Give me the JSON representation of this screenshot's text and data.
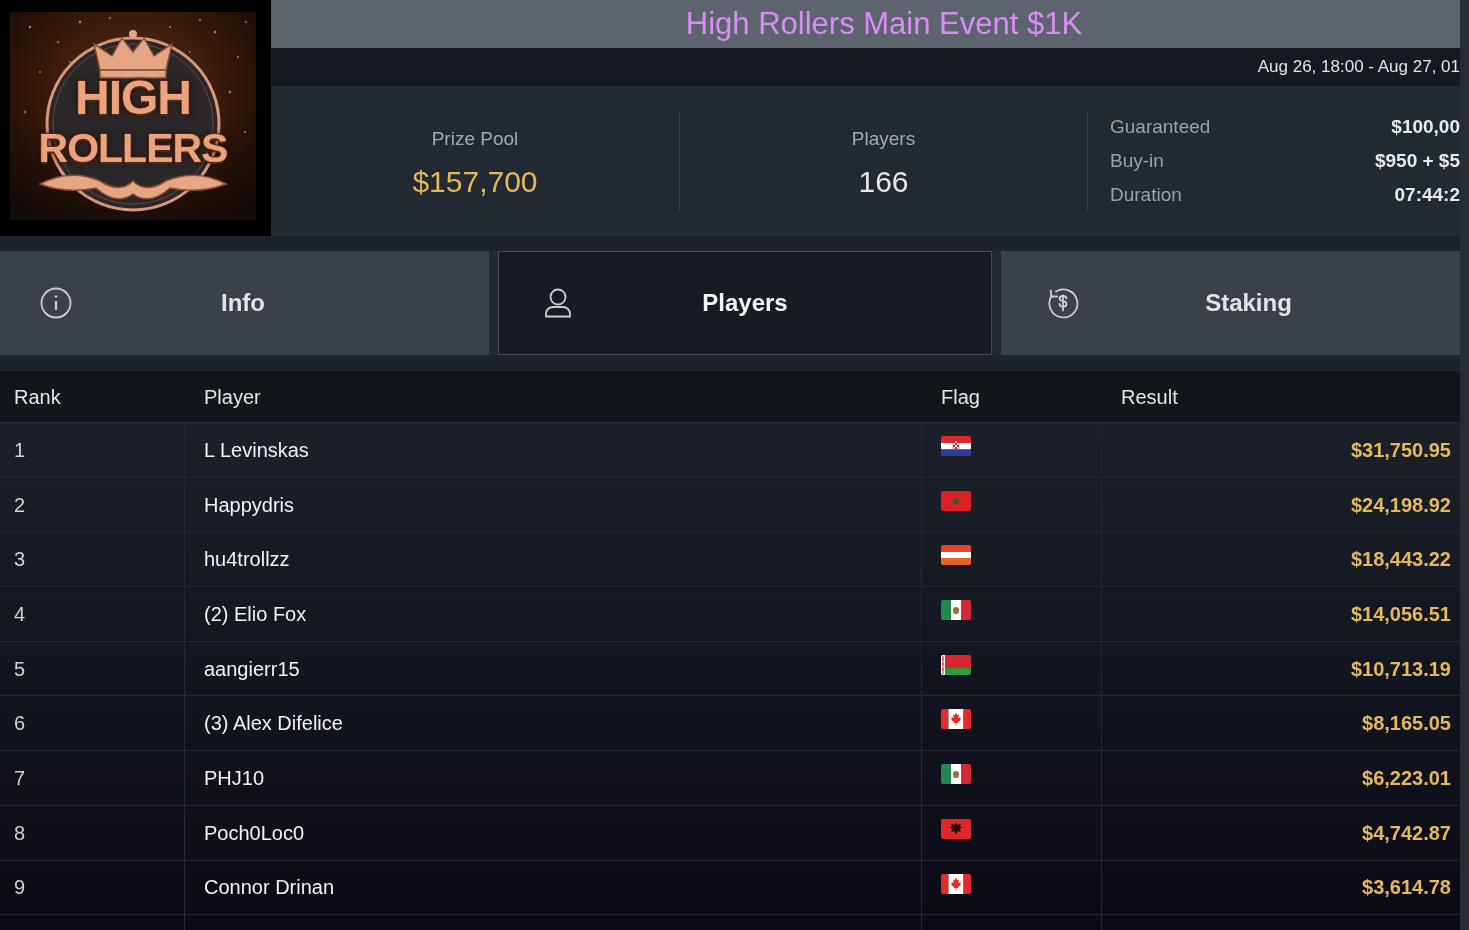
{
  "logo": {
    "lines": [
      "HIGH",
      "ROLLERS"
    ]
  },
  "title": "High Rollers Main Event $1K",
  "schedule": "Aug 26, 18:00 - Aug 27, 01",
  "stats": [
    {
      "label": "Prize Pool",
      "value": "$157,700",
      "highlight": true
    },
    {
      "label": "Players",
      "value": "166",
      "highlight": false
    }
  ],
  "details": [
    {
      "label": "Guaranteed",
      "value": "$100,00"
    },
    {
      "label": "Buy-in",
      "value": "$950 + $5"
    },
    {
      "label": "Duration",
      "value": "07:44:2"
    }
  ],
  "tabs": [
    {
      "label": "Info",
      "selected": false
    },
    {
      "label": "Players",
      "selected": true
    },
    {
      "label": "Staking",
      "selected": false
    }
  ],
  "table": {
    "columns": [
      "Rank",
      "Player",
      "Flag",
      "Result"
    ],
    "rows": [
      {
        "rank": "1",
        "player": "L Levinskas",
        "kind": "croatia",
        "result": "$31,750.95"
      },
      {
        "rank": "2",
        "player": "Happydris",
        "kind": "morocco",
        "result": "$24,198.92"
      },
      {
        "rank": "3",
        "player": "hu4trollzz",
        "kind": "austria",
        "result": "$18,443.22"
      },
      {
        "rank": "4",
        "player": "(2) Elio Fox",
        "kind": "mexico",
        "result": "$14,056.51"
      },
      {
        "rank": "5",
        "player": "aangierr15",
        "kind": "belarus",
        "result": "$10,713.19"
      },
      {
        "rank": "6",
        "player": "(3) Alex Difelice",
        "kind": "canada",
        "result": "$8,165.05"
      },
      {
        "rank": "7",
        "player": "PHJ10",
        "kind": "mexico",
        "result": "$6,223.01"
      },
      {
        "rank": "8",
        "player": "Poch0Loc0",
        "kind": "albania",
        "result": "$4,742.87"
      },
      {
        "rank": "9",
        "player": "Connor Drinan",
        "kind": "canada",
        "result": "$3,614.78"
      }
    ]
  }
}
